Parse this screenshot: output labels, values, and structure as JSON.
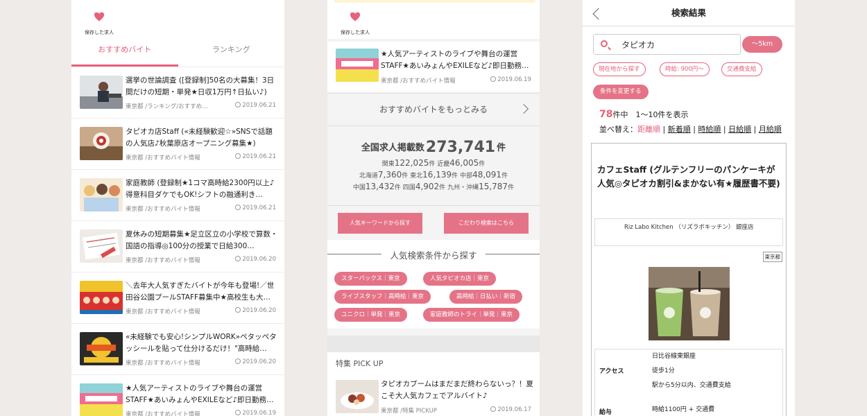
{
  "common": {
    "saved_label": "保存した求人"
  },
  "panel1": {
    "tabs": [
      {
        "label": "おすすめバイト",
        "active": true
      },
      {
        "label": "ランキング",
        "active": false
      }
    ],
    "items": [
      {
        "title": "選挙の世論調査 ([登録制]50名の大募集！3日間だけの短期・単発★日収1万円↑日払い♪)",
        "meta": "東京都 /ランキング/おすすめ…",
        "date": "2019.06.21"
      },
      {
        "title": "タピオカ店Staff («未経験歓迎☆»SNSで話題の人気店♪秋葉原店オープニング募集★)",
        "meta": "東京都 /おすすめバイト情報",
        "date": "2019.06.21"
      },
      {
        "title": "家庭教師 (登録制★1コマ高時給2300円以上♪得意科目ダケでもOK!シフトの融通利き…",
        "meta": "東京都 /おすすめバイト情報",
        "date": "2019.06.21"
      },
      {
        "title": "夏休みの短期募集★足立区立の小学校で算数・国語の指導◎100分の授業で日給300…",
        "meta": "東京都 /おすすめバイト情報",
        "date": "2019.06.20"
      },
      {
        "title": "＼去年大人気すぎたバイトが今年も登場!／世田谷公園プールSTAFF募集中★高校生も大…",
        "meta": "東京都 /おすすめバイト情報",
        "date": "2019.06.20"
      },
      {
        "title": "«未経験でも安心!シンプルWORK»ペタッペタッシールを貼って仕分けるだけ！\"高時給…",
        "meta": "東京都 /おすすめバイト情報",
        "date": "2019.06.20"
      },
      {
        "title": "★人気アーティストのライブや舞台の運営STAFF★あいみょんやEXILEなど♪即日勤務…",
        "meta": "東京都 /おすすめバイト情報",
        "date": "2019.06.19"
      }
    ]
  },
  "panel2": {
    "top_item": {
      "title": "★人気アーティストのライブや舞台の運営STAFF★あいみょんやEXILEなど♪即日勤務…",
      "meta": "東京都 /おすすめバイト情報",
      "date": "2019.06.19"
    },
    "more_label": "おすすめバイトをもっとみる",
    "stats": {
      "total_prefix": "全国求人掲載数",
      "total_value": "273,741",
      "total_suffix": "件",
      "rows": [
        [
          {
            "region": "関東",
            "value": "122,025",
            "unit": "件"
          },
          {
            "region": "近畿",
            "value": "46,005",
            "unit": "件"
          }
        ],
        [
          {
            "region": "北海道",
            "value": "7,360",
            "unit": "件"
          },
          {
            "region": "東北",
            "value": "16,139",
            "unit": "件"
          },
          {
            "region": "中部",
            "value": "48,091",
            "unit": "件"
          }
        ],
        [
          {
            "region": "中国",
            "value": "13,432",
            "unit": "件"
          },
          {
            "region": "四国",
            "value": "4,902",
            "unit": "件"
          },
          {
            "region": "九州・沖縄",
            "value": "15,787",
            "unit": "件"
          }
        ]
      ]
    },
    "keyword_button": "人気キーワードから探す",
    "detail_button": "こだわり検索はこちら",
    "popular_heading": "人気検索条件から探す",
    "chips": [
      "スターバックス｜東京",
      "人気タピオカ店｜東京",
      "ライブスタッフ｜高時給｜東京",
      "高時給｜日払い｜新宿",
      "ユニクロ｜単発｜東京",
      "家庭教師のトライ｜単発｜東京"
    ],
    "pickup_heading": "特集 PICK UP",
    "pickup_item": {
      "title": "タピオカブームはまだまだ終わらないっ？！夏こそ大人気カフェでアルバイト♪",
      "meta": "東京都 /特集 PICKUP",
      "date": "2019.06.17"
    }
  },
  "panel3": {
    "title": "検索結果",
    "search_value": "タピオカ",
    "distance": "〜5km",
    "filters": [
      "現在地から探す",
      "時給: 900円〜",
      "交通費支給"
    ],
    "change_label": "条件を変更する",
    "count_value": "78",
    "count_unit": "件中",
    "count_range": "1〜10件を表示",
    "sort_label": "並べ替え：",
    "sort_options": [
      "距離順",
      "新着順",
      "時給順",
      "日給順",
      "月給順"
    ],
    "job": {
      "title": "カフェStaff (グルテンフリーのパンケーキが人気◎タピオカ割引&まかない有★履歴書不要)",
      "shop": "Riz Labo Kitchen （リズラボキッチン） 銀座店",
      "area": "東京都",
      "access_label": "アクセス",
      "access_lines": [
        "日比谷線東銀座",
        "徒歩1分",
        "駅から5分以内、交通費支給"
      ],
      "salary_label": "給与",
      "salary": "時給1100円 + 交通費"
    }
  },
  "colors": {
    "accent": "#e8617a",
    "button": "#e57387"
  }
}
